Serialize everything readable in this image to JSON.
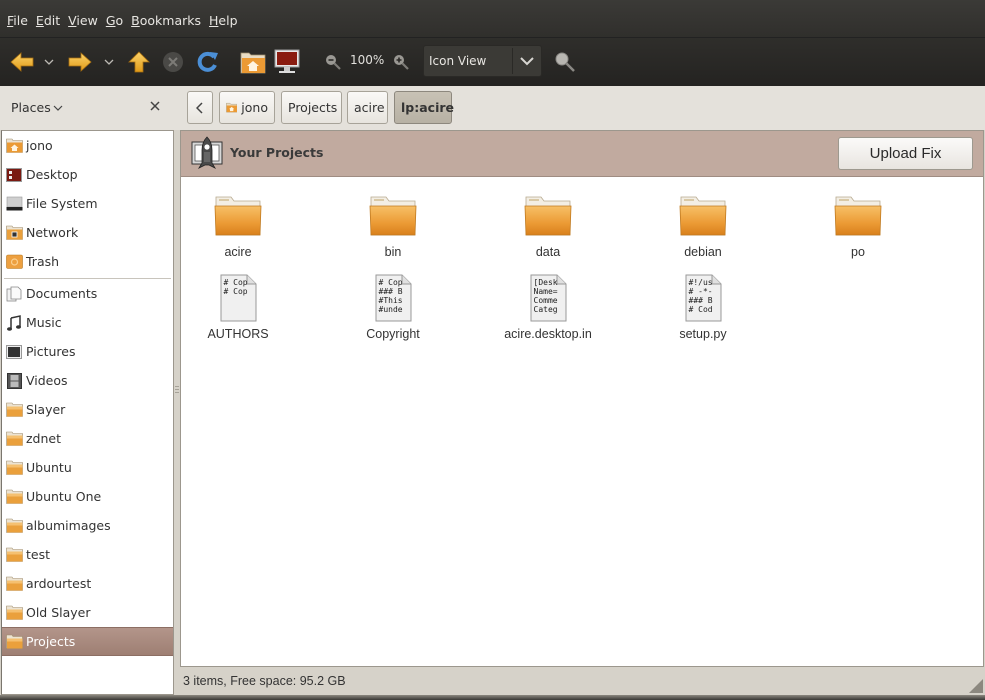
{
  "menubar": {
    "items": [
      {
        "acc": "F",
        "rest": "ile"
      },
      {
        "acc": "E",
        "rest": "dit"
      },
      {
        "acc": "V",
        "rest": "iew"
      },
      {
        "acc": "G",
        "rest": "o"
      },
      {
        "acc": "B",
        "rest": "ookmarks"
      },
      {
        "acc": "H",
        "rest": "elp"
      }
    ]
  },
  "toolbar": {
    "zoom_level": "100%",
    "view_mode": "Icon View",
    "icons": [
      "back-arrow-icon",
      "forward-arrow-icon",
      "up-arrow-icon",
      "stop-icon",
      "reload-icon",
      "home-folder-icon",
      "computer-icon",
      "zoom-out-icon",
      "zoom-in-icon",
      "search-icon"
    ]
  },
  "sidebar": {
    "title": "Places",
    "items": [
      {
        "label": "jono",
        "icon": "home-folder-icon"
      },
      {
        "label": "Desktop",
        "icon": "desktop-icon"
      },
      {
        "label": "File System",
        "icon": "drive-icon"
      },
      {
        "label": "Network",
        "icon": "network-folder-icon"
      },
      {
        "label": "Trash",
        "icon": "trash-icon"
      },
      {
        "label": "Documents",
        "icon": "documents-icon"
      },
      {
        "label": "Music",
        "icon": "music-icon"
      },
      {
        "label": "Pictures",
        "icon": "pictures-icon"
      },
      {
        "label": "Videos",
        "icon": "videos-icon"
      },
      {
        "label": "Slayer",
        "icon": "folder-icon"
      },
      {
        "label": "zdnet",
        "icon": "folder-icon"
      },
      {
        "label": "Ubuntu",
        "icon": "folder-icon"
      },
      {
        "label": "Ubuntu One",
        "icon": "folder-icon"
      },
      {
        "label": "albumimages",
        "icon": "folder-icon"
      },
      {
        "label": "test",
        "icon": "folder-icon"
      },
      {
        "label": "ardourtest",
        "icon": "folder-icon"
      },
      {
        "label": "Old Slayer",
        "icon": "folder-icon"
      },
      {
        "label": "Projects",
        "icon": "folder-icon",
        "selected": true
      }
    ]
  },
  "pathbar": {
    "crumbs": [
      "jono",
      "Projects",
      "acire",
      "lp:acire"
    ],
    "active_index": 3
  },
  "banner": {
    "title": "Your Projects",
    "button_label": "Upload Fix"
  },
  "files": [
    {
      "name": "acire",
      "type": "folder"
    },
    {
      "name": "bin",
      "type": "folder"
    },
    {
      "name": "data",
      "type": "folder"
    },
    {
      "name": "debian",
      "type": "folder"
    },
    {
      "name": "po",
      "type": "folder"
    },
    {
      "name": "AUTHORS",
      "type": "text",
      "preview": "# Cop\n# Cop"
    },
    {
      "name": "Copyright",
      "type": "text",
      "preview": "# Cop\n### B\n#This\n#unde"
    },
    {
      "name": "acire.desktop.in",
      "type": "text",
      "preview": "[Desk\nName=\nComme\nCateg"
    },
    {
      "name": "setup.py",
      "type": "text",
      "preview": "#!/us\n# -*-\n### B\n# Cod"
    }
  ],
  "status": {
    "text": "3 items, Free space: 95.2 GB"
  },
  "colors": {
    "accent_selected": "#a88a7e",
    "banner": "#c1aa9f",
    "folder": "#e8952f"
  }
}
